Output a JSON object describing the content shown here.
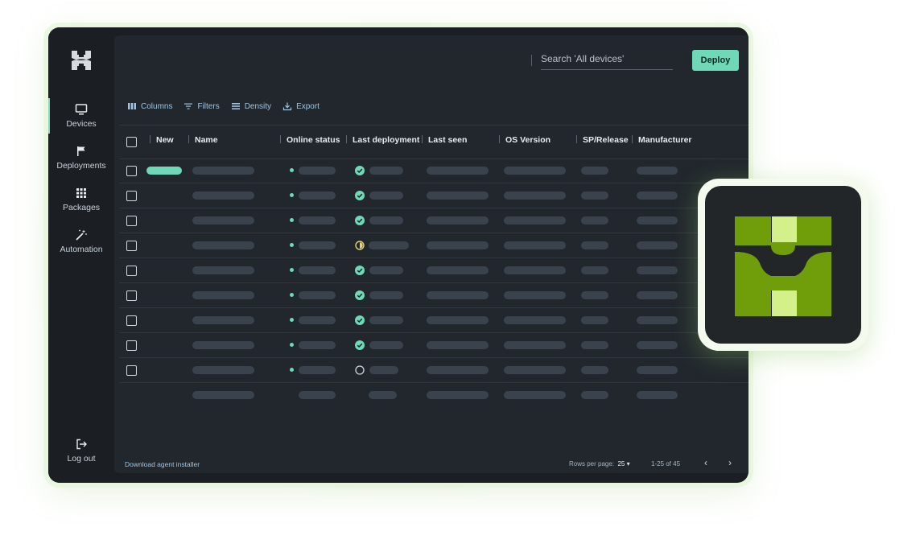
{
  "app": {
    "logo_icon": "castle-h-logo-icon"
  },
  "sidebar": {
    "items": [
      {
        "label": "Devices",
        "icon": "monitor-icon",
        "active": true
      },
      {
        "label": "Deployments",
        "icon": "flag-icon",
        "active": false
      },
      {
        "label": "Packages",
        "icon": "grid-icon",
        "active": false
      },
      {
        "label": "Automation",
        "icon": "magic-wand-icon",
        "active": false
      }
    ],
    "logout_label": "Log out"
  },
  "header": {
    "search_placeholder": "Search 'All devices'",
    "deploy_label": "Deploy"
  },
  "toolbar": {
    "columns": "Columns",
    "filters": "Filters",
    "density": "Density",
    "export": "Export"
  },
  "table": {
    "columns": [
      "New",
      "Name",
      "Online status",
      "Last deployment",
      "Last seen",
      "OS Version",
      "SP/Release",
      "Manufacturer"
    ],
    "rows": [
      {
        "new": true,
        "deployment_status": "success"
      },
      {
        "new": false,
        "deployment_status": "success"
      },
      {
        "new": false,
        "deployment_status": "success"
      },
      {
        "new": false,
        "deployment_status": "in-progress"
      },
      {
        "new": false,
        "deployment_status": "success"
      },
      {
        "new": false,
        "deployment_status": "success"
      },
      {
        "new": false,
        "deployment_status": "success"
      },
      {
        "new": false,
        "deployment_status": "success"
      },
      {
        "new": false,
        "deployment_status": "pending"
      }
    ]
  },
  "footer": {
    "download_link": "Download agent installer",
    "rows_per_page_label": "Rows per page:",
    "rows_per_page_value": "25",
    "range": "1-25 of 45"
  },
  "colors": {
    "accent": "#6fd9b7",
    "logo_green": "#6f9e0a",
    "logo_light": "#d4f08a",
    "background": "#1b1f24"
  }
}
